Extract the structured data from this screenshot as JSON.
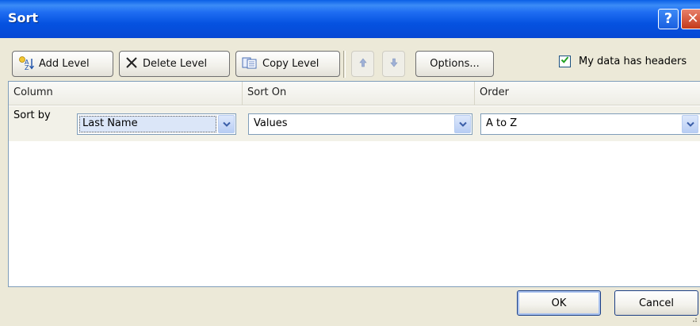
{
  "window": {
    "title": "Sort"
  },
  "title_buttons": {
    "help_glyph": "?",
    "close_glyph": "✕"
  },
  "toolbar": {
    "add_level": "Add Level",
    "delete_level": "Delete Level",
    "copy_level": "Copy Level",
    "options": "Options...",
    "my_data_has_headers": "My data has headers",
    "headers_checked": true
  },
  "grid": {
    "columns": [
      "Column",
      "Sort On",
      "Order"
    ],
    "rows": [
      {
        "label": "Sort by",
        "column": "Last Name",
        "sort_on": "Values",
        "order": "A to Z"
      }
    ]
  },
  "footer": {
    "ok": "OK",
    "cancel": "Cancel"
  },
  "colors": {
    "titlebar": "#0552e0",
    "dialog_bg": "#ece9d8",
    "selection": "#dbe6f8",
    "combo_arrow": "#3a5ea8"
  }
}
